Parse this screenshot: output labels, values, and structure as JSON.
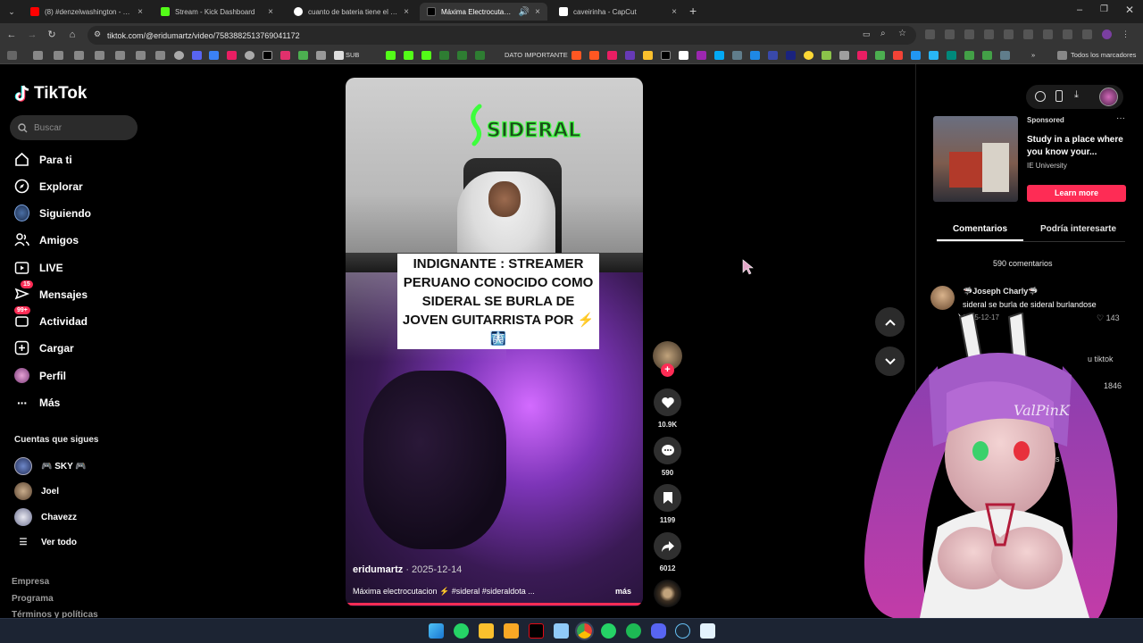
{
  "browser": {
    "tabs": [
      {
        "label": "(8) #denzelwashington - YouTube",
        "color": "#ff0000",
        "active": false
      },
      {
        "label": "Stream - Kick Dashboard",
        "color": "#53fc18",
        "active": false
      },
      {
        "label": "cuanto de bateria tiene el sams",
        "color": "#ffffff",
        "active": false
      },
      {
        "label": "Máxima Electrocutación: Si...",
        "color": "#000000",
        "active": true
      },
      {
        "label": "caveirinha - CapCut",
        "color": "#ffffff",
        "active": false
      }
    ],
    "url": "tiktok.com/@eridumartz/video/7583882513769041172",
    "bookmarks": {
      "sub_label": "SUB",
      "dato_label": "DATO IMPORTANTE",
      "all_label": "Todos los marcadores"
    }
  },
  "sidebar": {
    "logo": "TikTok",
    "search_placeholder": "Buscar",
    "nav": [
      {
        "label": "Para ti",
        "icon": "home-icon"
      },
      {
        "label": "Explorar",
        "icon": "compass-icon"
      },
      {
        "label": "Siguiendo",
        "icon": "following-avatar-icon"
      },
      {
        "label": "Amigos",
        "icon": "friends-icon"
      },
      {
        "label": "LIVE",
        "icon": "live-icon"
      },
      {
        "label": "Mensajes",
        "icon": "messages-icon",
        "badge": "15"
      },
      {
        "label": "Actividad",
        "icon": "activity-icon",
        "badge": "99+"
      },
      {
        "label": "Cargar",
        "icon": "upload-icon"
      },
      {
        "label": "Perfil",
        "icon": "profile-avatar-icon"
      },
      {
        "label": "Más",
        "icon": "more-icon"
      }
    ],
    "following_title": "Cuentas que sigues",
    "following": [
      {
        "name": "🎮 SKY 🎮"
      },
      {
        "name": "Joel"
      },
      {
        "name": "Chavezz"
      }
    ],
    "see_all": "Ver todo",
    "footer": [
      "Empresa",
      "Programa",
      "Términos y políticas"
    ]
  },
  "video": {
    "overlay_text": "INDIGNANTE : STREAMER PERUANO CONOCIDO COMO SIDERAL SE BURLA DE JOVEN GUITARRISTA POR ⚡🩻",
    "logo_text": "SIDERAL",
    "author": "eridumartz",
    "date": "· 2025-12-14",
    "description": "Máxima electrocutacion ⚡ #sideral #sideraldota ...",
    "more": "más"
  },
  "actions": {
    "likes": "10.9K",
    "comments": "590",
    "saves": "1199",
    "shares": "6012"
  },
  "ad": {
    "sponsored": "Sponsored",
    "title": "Study in a place where you know your...",
    "brand": "IE University",
    "cta": "Learn more"
  },
  "comments_panel": {
    "tab_comments": "Comentarios",
    "tab_interest": "Podría interesarte",
    "count": "590 comentarios",
    "first": {
      "name": "🦈Joseph Charly🦈",
      "text": "sideral se burla de sideral burlandose",
      "date": "2025-12-17",
      "likes": "143"
    },
    "partial_1": "u tiktok",
    "partial_2": "1846",
    "partial_3": "is"
  },
  "vtuber": {
    "watermark": "ValPinK"
  },
  "colors": {
    "accent": "#fe2c55",
    "background": "#000000"
  }
}
